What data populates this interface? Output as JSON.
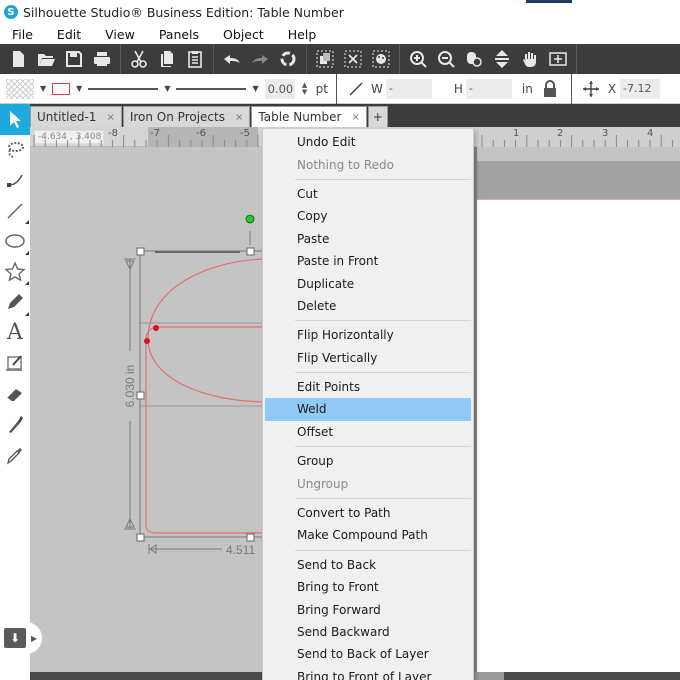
{
  "window": {
    "title": "Silhouette Studio® Business Edition: Table Number",
    "logo_glyph": "S",
    "accent_color": "#1ea9df"
  },
  "menubar": {
    "items": [
      "File",
      "Edit",
      "View",
      "Panels",
      "Object",
      "Help"
    ]
  },
  "toolbar": {
    "groups": [
      [
        "new-document-icon",
        "open-folder-icon",
        "save-icon",
        "print-icon"
      ],
      [
        "cut-icon",
        "copy-icon",
        "paste-icon"
      ],
      [
        "undo-icon",
        "redo-icon",
        "refresh-icon"
      ],
      [
        "select-all-icon",
        "deselect-icon",
        "edit-select-icon"
      ],
      [
        "zoom-in-icon",
        "zoom-out-icon",
        "zoom-select-icon",
        "fit-to-page-icon",
        "pan-hand-icon",
        "zoom-fit-icon"
      ]
    ]
  },
  "propbar": {
    "line_width_value": "0.00",
    "line_width_unit": "pt",
    "width_label": "W",
    "width_value": "-",
    "height_label": "H",
    "height_value": "-",
    "size_unit": "in",
    "x_label": "X",
    "x_value": "-7.12"
  },
  "tools": [
    {
      "name": "select-tool",
      "icon": "pointer-icon",
      "active": true
    },
    {
      "name": "point-edit-tool",
      "icon": "lasso-icon",
      "active": false
    },
    {
      "name": "curve-tool",
      "icon": "curve-icon",
      "active": false
    },
    {
      "name": "line-tool",
      "icon": "line-icon",
      "active": false
    },
    {
      "name": "ellipse-tool",
      "icon": "ellipse-icon",
      "active": false
    },
    {
      "name": "polygon-tool",
      "icon": "star-icon",
      "active": false
    },
    {
      "name": "draw-tool",
      "icon": "pencil-icon",
      "active": false
    },
    {
      "name": "text-tool",
      "icon": "text-icon",
      "active": false
    },
    {
      "name": "sketch-tool",
      "icon": "sketch-icon",
      "active": false
    },
    {
      "name": "eraser-tool",
      "icon": "eraser-icon",
      "active": false
    },
    {
      "name": "knife-tool",
      "icon": "knife-icon",
      "active": false
    },
    {
      "name": "eyedropper-tool",
      "icon": "eyedropper-icon",
      "active": false
    }
  ],
  "tabs": [
    {
      "label": "Untitled-1",
      "active": false
    },
    {
      "label": "Iron On Projects",
      "active": false
    },
    {
      "label": "Table Number",
      "active": true
    }
  ],
  "tab_close_glyph": "×",
  "tab_add_glyph": "+",
  "ruler": {
    "coordinates": "-4.634 , 3.408",
    "labels": [
      "-8",
      "-7",
      "-6",
      "-5",
      "1",
      "2",
      "3",
      "4"
    ]
  },
  "selection": {
    "height_label": "6.030 in",
    "width_label": "4.511"
  },
  "context_menu": {
    "sections": [
      [
        {
          "label": "Undo Edit",
          "disabled": false
        },
        {
          "label": "Nothing to Redo",
          "disabled": true
        }
      ],
      [
        {
          "label": "Cut"
        },
        {
          "label": "Copy"
        },
        {
          "label": "Paste"
        },
        {
          "label": "Paste in Front"
        },
        {
          "label": "Duplicate"
        },
        {
          "label": "Delete"
        }
      ],
      [
        {
          "label": "Flip Horizontally"
        },
        {
          "label": "Flip Vertically"
        }
      ],
      [
        {
          "label": "Edit Points"
        },
        {
          "label": "Weld",
          "highlighted": true
        },
        {
          "label": "Offset"
        }
      ],
      [
        {
          "label": "Group"
        },
        {
          "label": "Ungroup",
          "disabled": true
        }
      ],
      [
        {
          "label": "Convert to Path"
        },
        {
          "label": "Make Compound Path"
        }
      ],
      [
        {
          "label": "Send to Back"
        },
        {
          "label": "Bring to Front"
        },
        {
          "label": "Bring Forward"
        },
        {
          "label": "Send Backward"
        },
        {
          "label": "Send to Back of Layer"
        },
        {
          "label": "Bring to Front of Layer"
        }
      ]
    ]
  },
  "colors": {
    "toolbar_bg": "#3c3c3c",
    "highlight": "#90c8f6",
    "shape_stroke": "#e07070",
    "rotate_handle": "#22cc22"
  }
}
